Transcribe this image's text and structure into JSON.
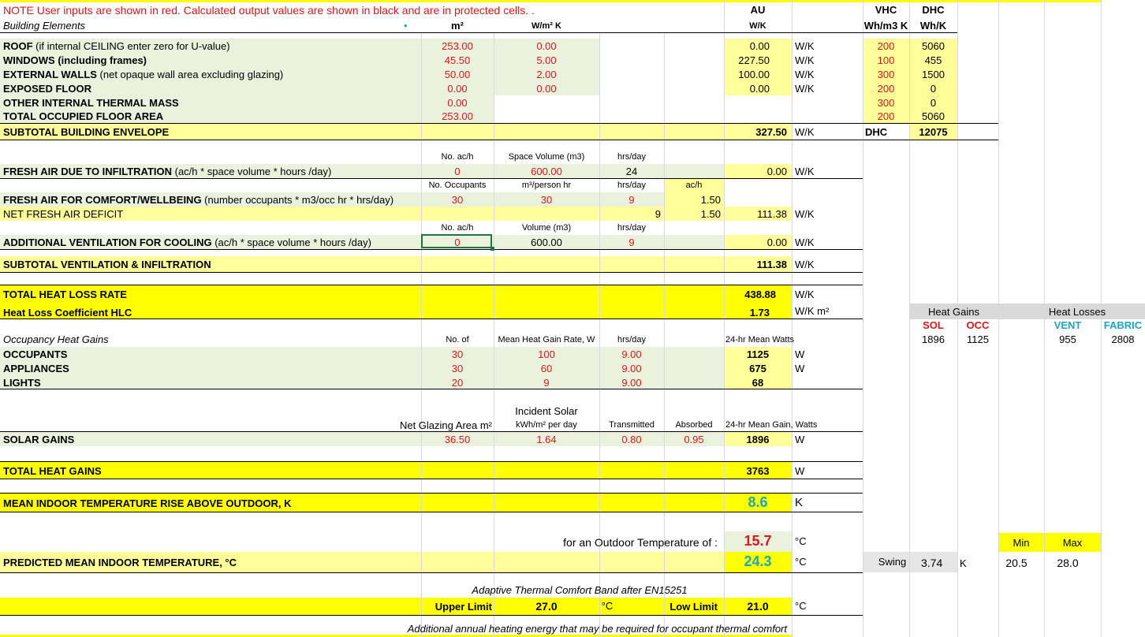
{
  "note": "NOTE User inputs are shown in red. Calculated output values are shown in black and are in protected cells. .",
  "headers": {
    "building_elements": "Building Elements",
    "m2": "m²",
    "wm2k": "W/m² K",
    "au": "AU",
    "wk": "W/K",
    "vhc": "VHC",
    "dhc": "DHC",
    "vhc_unit": "Wh/m3 K",
    "dhc_unit": "Wh/K"
  },
  "envelope": [
    {
      "label_b": "ROOF",
      "label_n": " (if internal CEILING enter zero for U-value)",
      "area": "253.00",
      "u": "0.00",
      "au": "0.00",
      "unit": "W/K",
      "vhc": "200",
      "dhc": "5060"
    },
    {
      "label_b": "WINDOWS (including frames)",
      "label_n": "",
      "area": "45.50",
      "u": "5.00",
      "au": "227.50",
      "unit": "W/K",
      "vhc": "100",
      "dhc": "455"
    },
    {
      "label_b": "EXTERNAL WALLS",
      "label_n": " (net opaque wall area excluding glazing)",
      "area": "50.00",
      "u": "2.00",
      "au": "100.00",
      "unit": "W/K",
      "vhc": "300",
      "dhc": "1500"
    },
    {
      "label_b": "EXPOSED FLOOR",
      "label_n": "",
      "area": "0.00",
      "u": "0.00",
      "au": "0.00",
      "unit": "W/K",
      "vhc": "200",
      "dhc": "0"
    },
    {
      "label_b": "OTHER INTERNAL THERMAL MASS",
      "label_n": "",
      "area": "0.00",
      "u": "",
      "au": "",
      "unit": "",
      "vhc": "300",
      "dhc": "0"
    },
    {
      "label_b": "TOTAL OCCUPIED FLOOR AREA",
      "label_n": "",
      "area": "253.00",
      "u": "",
      "au": "",
      "unit": "",
      "vhc": "200",
      "dhc": "5060"
    }
  ],
  "subtotal_envelope": {
    "label": "SUBTOTAL BUILDING ENVELOPE",
    "value": "327.50",
    "unit": "W/K",
    "dhc_label": "DHC",
    "dhc_value": "12075"
  },
  "infiltration": {
    "h1": "No. ac/h",
    "h2": "Space Volume (m3)",
    "h3": "hrs/day",
    "label_b": "FRESH AIR DUE TO INFILTRATION",
    "label_n": " (ac/h *  space volume * hours /day)",
    "ach": "0",
    "vol": "600.00",
    "hrs": "24",
    "value": "0.00",
    "unit": "W/K"
  },
  "comfort": {
    "h1": "No. Occupants",
    "h2": "m³/person hr",
    "h3": "hrs/day",
    "h4": "ac/h",
    "label_b": "FRESH AIR FOR COMFORT/WELLBEING",
    "label_n": " (number occupants * m3/occ hr * hrs/day)",
    "occ": "30",
    "rate": "30",
    "hrs": "9",
    "ach": "1.50"
  },
  "deficit": {
    "label": "NET FRESH AIR DEFICIT",
    "hrs": "9",
    "ach": "1.50",
    "value": "111.38",
    "unit": "W/K"
  },
  "cooling": {
    "h1": "No. ac/h",
    "h2": "Volume (m3)",
    "h3": "hrs/day",
    "label_b": "ADDITIONAL VENTILATION FOR COOLING",
    "label_n": " (ac/h * space volume * hours /day)",
    "ach": "0",
    "vol": "600.00",
    "hrs": "9",
    "value": "0.00",
    "unit": "W/K"
  },
  "subtotal_vent": {
    "label": "SUBTOTAL VENTILATION & INFILTRATION",
    "value": "111.38",
    "unit": "W/K"
  },
  "total_loss": {
    "label": "TOTAL HEAT LOSS RATE",
    "value": "438.88",
    "unit": "W/K"
  },
  "hlc": {
    "label": "Heat Loss Coefficient HLC",
    "value": "1.73",
    "unit": "W/K m²"
  },
  "summary": {
    "gains_title": "Heat Gains",
    "losses_title": "Heat Losses",
    "sol": "SOL",
    "occ": "OCC",
    "vent": "VENT",
    "fabric": "FABRIC",
    "sol_v": "1896",
    "occ_v": "1125",
    "vent_v": "955",
    "fabric_v": "2808"
  },
  "occupancy": {
    "title": "Occupancy Heat Gains",
    "h1": "No. of",
    "h2": "Mean Heat Gain Rate, W",
    "h3": "hrs/day",
    "h4": "24-hr Mean Watts",
    "rows": [
      {
        "label": "OCCUPANTS",
        "n": "30",
        "rate": "100",
        "hrs": "9.00",
        "w": "1125",
        "unit": "W"
      },
      {
        "label": "APPLIANCES",
        "n": "30",
        "rate": "60",
        "hrs": "9.00",
        "w": "675",
        "unit": "W"
      },
      {
        "label": "LIGHTS",
        "n": "20",
        "rate": "9",
        "hrs": "9.00",
        "w": "68",
        "unit": ""
      }
    ]
  },
  "solar": {
    "h0": "Incident Solar",
    "h1": "Net Glazing Area  m²",
    "h2": "kWh/m² per day",
    "h3": "Transmitted",
    "h4": "Absorbed",
    "h5": "24-hr Mean Gain, Watts",
    "label": "SOLAR GAINS",
    "area": "36.50",
    "kwh": "1.64",
    "trans": "0.80",
    "abs": "0.95",
    "w": "1896",
    "unit": "W"
  },
  "total_gains": {
    "label": "TOTAL HEAT GAINS",
    "value": "3763",
    "unit": "W"
  },
  "rise": {
    "label": "MEAN INDOOR TEMPERATURE RISE ABOVE OUTDOOR, K",
    "value": "8.6",
    "unit": "K"
  },
  "outdoor": {
    "label": "for an Outdoor Temperature of :",
    "value": "15.7",
    "unit": "°C"
  },
  "predicted": {
    "label": "PREDICTED MEAN INDOOR TEMPERATURE, °C",
    "value": "24.3",
    "unit": "°C",
    "swing_label": "Swing",
    "swing": "3.74",
    "swing_unit": "K",
    "min_label": "Min",
    "max_label": "Max",
    "min": "20.5",
    "max": "28.0"
  },
  "comfort_band": {
    "title": "Adaptive Thermal Comfort Band after EN15251",
    "upper_label": "Upper Limit",
    "upper": "27.0",
    "upper_unit": "°C",
    "lower_label": "Low Limit",
    "lower": "21.0",
    "lower_unit": "°C"
  },
  "footer": "Additional annual heating energy that may be required for occupant thermal comfort"
}
